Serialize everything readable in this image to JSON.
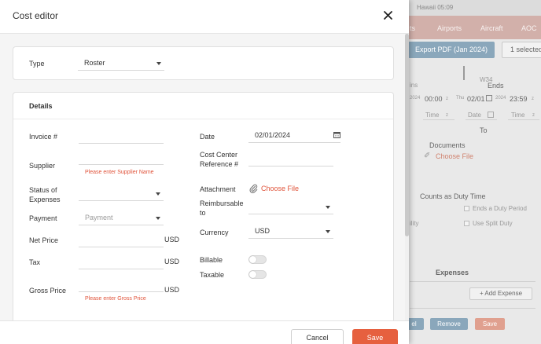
{
  "background": {
    "time": "Hawaii 05:09",
    "nav": [
      "ts",
      "Airports",
      "Aircraft",
      "AOC"
    ],
    "export_btn": "Export PDF (Jan 2024)",
    "selected_btn": "1 selected",
    "week": "W34",
    "ends": "Ends",
    "ins": "ins",
    "start_year": "2024",
    "start_time": "00:00",
    "z1": "z",
    "thu": "Thu",
    "end_date": "02/01",
    "end_year": "2024",
    "end_time": "23:59",
    "z2": "z",
    "time_ph1": "Time",
    "z3": "z",
    "date_ph": "Date",
    "time_ph2": "Time",
    "z4": "z",
    "to": "To",
    "documents": "Documents",
    "choose_file": "Choose File",
    "duty_time": "Counts as Duty Time",
    "ends_duty": "Ends a Duty Period",
    "ility": "ility",
    "split_duty": "Use Split Duty",
    "expenses": "Expenses",
    "add_expense": "+ Add Expense",
    "btn_el": "el",
    "btn_remove": "Remove",
    "btn_save": "Save",
    "colors": {
      "nav": "#d2b0aa",
      "pdf": "#8aa7bb",
      "remove": "#8aa7bb",
      "save": "#e0a08f"
    }
  },
  "modal": {
    "title": "Cost editor",
    "type": {
      "label": "Type",
      "value": "Roster"
    },
    "details_title": "Details",
    "left": {
      "invoice_label": "Invoice #",
      "invoice_value": "",
      "supplier_label": "Supplier",
      "supplier_value": "",
      "supplier_error": "Please enter Supplier Name",
      "status_label_1": "Status of",
      "status_label_2": "Expenses",
      "status_value": "",
      "payment_label": "Payment",
      "payment_placeholder": "Payment",
      "net_label": "Net Price",
      "net_value": "",
      "net_unit": "USD",
      "tax_label": "Tax",
      "tax_value": "",
      "tax_unit": "USD",
      "gross_label": "Gross Price",
      "gross_value": "",
      "gross_unit": "USD",
      "gross_error": "Please enter Gross Price"
    },
    "right": {
      "date_label": "Date",
      "date_value": "02/01/2024",
      "cost_center_label_1": "Cost Center",
      "cost_center_label_2": "Reference #",
      "cost_center_value": "",
      "attachment_label": "Attachment",
      "attachment_link": "Choose File",
      "reimbursable_label_1": "Reimbursable",
      "reimbursable_label_2": "to",
      "reimbursable_value": "",
      "currency_label": "Currency",
      "currency_value": "USD",
      "billable_label": "Billable",
      "billable_on": false,
      "taxable_label": "Taxable",
      "taxable_on": false
    },
    "cancel_label": "Cancel",
    "save_label": "Save",
    "colors": {
      "accent": "#e6603f",
      "error": "#e0533a"
    },
    "icons": [
      "close-icon",
      "calendar-icon",
      "paperclip-icon",
      "chevron-down-icon"
    ]
  }
}
